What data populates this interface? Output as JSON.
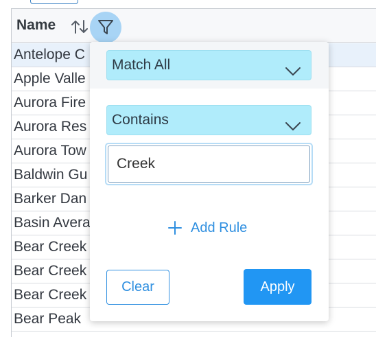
{
  "table": {
    "header": {
      "name_label": "Name"
    },
    "rows": [
      "Antelope C",
      "Apple Valle",
      "Aurora Fire",
      "Aurora Res",
      "Aurora Tow",
      "Baldwin Gu",
      "Barker Dan",
      "Basin Avera",
      "Bear Creek",
      "Bear Creek",
      "Bear Creek",
      "Bear Peak"
    ]
  },
  "filter_popup": {
    "operator_select": "Match All",
    "rule_select": "Contains",
    "rule_value": "Creek",
    "add_rule_label": "Add Rule",
    "clear_label": "Clear",
    "apply_label": "Apply"
  },
  "colors": {
    "accent": "#2196f3",
    "select_bg": "#b0ecfb",
    "filter_btn_bg": "#a8d4f5",
    "row_highlight": "#e8f1fb"
  },
  "icons": {
    "sort": "sort-icon",
    "filter": "filter-icon",
    "chevron": "chevron-down-icon",
    "plus": "plus-icon"
  }
}
